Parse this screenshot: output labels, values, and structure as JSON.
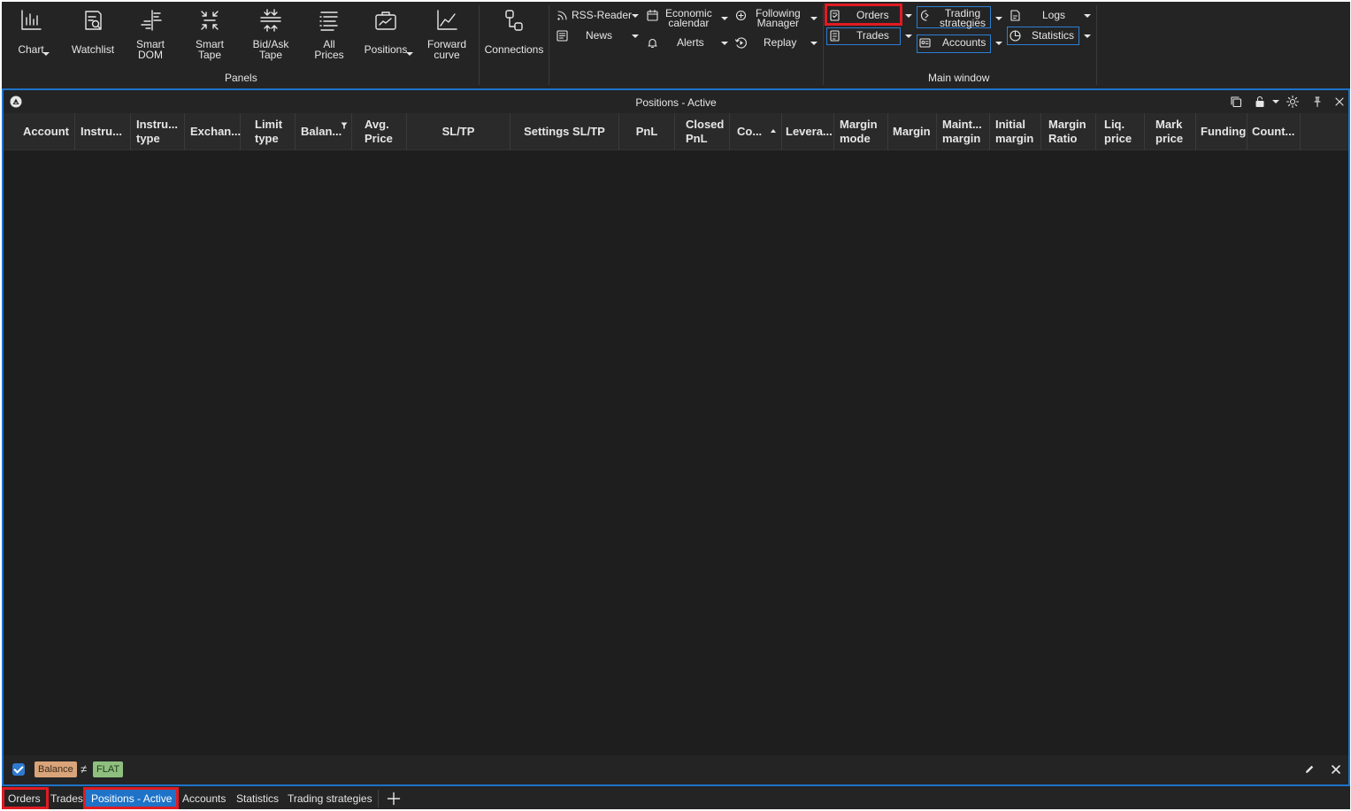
{
  "ribbon": {
    "panels": {
      "chart": "Chart",
      "watchlist": "Watchlist",
      "smart_dom": "Smart\nDOM",
      "smart_tape": "Smart\nTape",
      "bid_ask_tape": "Bid/Ask\nTape",
      "all_prices": "All\nPrices",
      "positions": "Positions",
      "forward_curve": "Forward\ncurve",
      "group_label": "Panels"
    },
    "connections": "Connections",
    "tools": {
      "rss_reader": "RSS-Reader",
      "news": "News",
      "economic_calendar": "Economic\ncalendar",
      "alerts": "Alerts",
      "following_manager": "Following\nManager",
      "replay": "Replay"
    },
    "main_window": {
      "orders": "Orders",
      "trades": "Trades",
      "trading_strategies": "Trading\nstrategies",
      "accounts": "Accounts",
      "logs": "Logs",
      "statistics": "Statistics",
      "group_label": "Main window"
    }
  },
  "panel": {
    "title": "Positions - Active",
    "columns": [
      "Account",
      "Instru...",
      "Instru...\ntype",
      "Exchan...",
      "Limit\ntype",
      "Balan...",
      "Avg.\nPrice",
      "SL/TP",
      "Settings SL/TP",
      "PnL",
      "Closed\nPnL",
      "Co...",
      "Levera...",
      "Margin\nmode",
      "Margin",
      "Maint...\nmargin",
      "Initial\nmargin",
      "Margin\nRatio",
      "Liq.\nprice",
      "Mark\nprice",
      "Funding",
      "Count..."
    ],
    "filter": {
      "field": "Balance",
      "operator": "≠",
      "value": "FLAT"
    }
  },
  "tabs": [
    "Orders",
    "Trades",
    "Positions - Active",
    "Accounts",
    "Statistics",
    "Trading strategies"
  ],
  "colors": {
    "accent_blue": "#1e73c8",
    "highlight_red": "#e11b22",
    "background": "#242424"
  }
}
